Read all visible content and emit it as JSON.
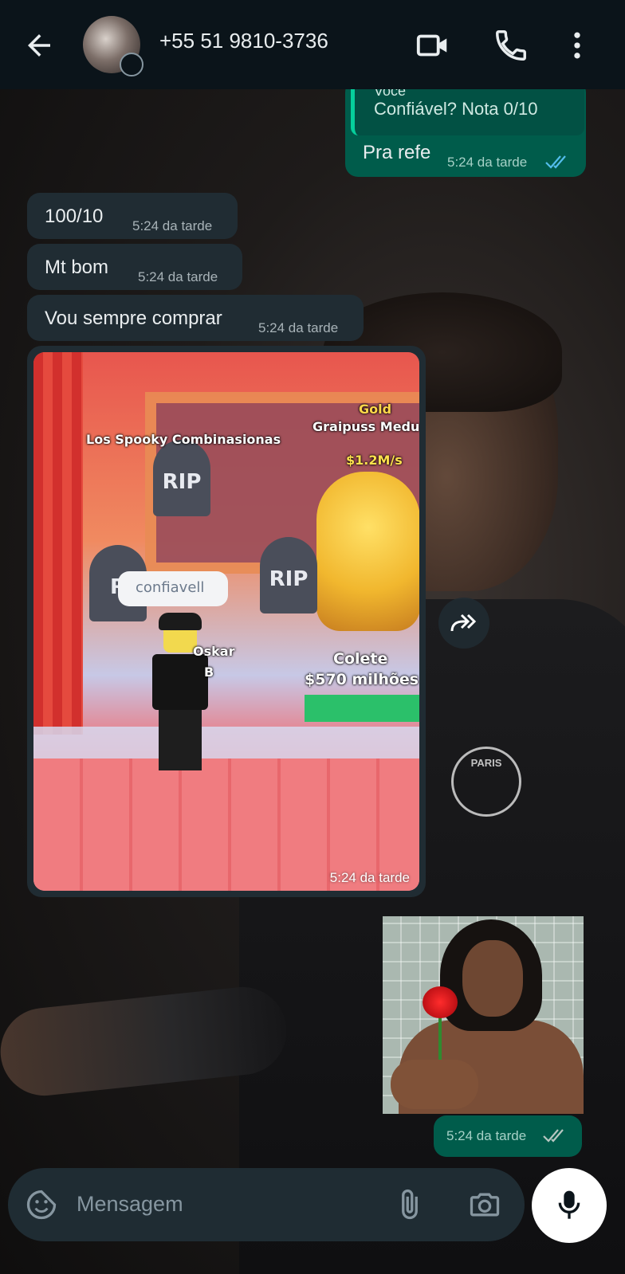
{
  "header": {
    "contact_name": "+55 51 9810-3736",
    "icons": [
      "back-arrow-icon",
      "video-call-icon",
      "phone-call-icon",
      "more-options-icon"
    ]
  },
  "messages": {
    "quoted": {
      "sender_partial": "Você",
      "text": "Confiável? Nota 0/10"
    },
    "m1": {
      "text": "Pra refe",
      "time": "5:24 da tarde",
      "status": "read"
    },
    "m2": {
      "text": "100/10",
      "time": "5:24 da tarde"
    },
    "m3": {
      "text": "Mt bom",
      "time": "5:24 da tarde"
    },
    "m4": {
      "text": "Vou sempre comprar",
      "time": "5:24 da tarde"
    },
    "media": {
      "time": "5:24 da tarde",
      "game_text": {
        "sign_title": "Los Spooky Combinasionas",
        "gold": "Gold",
        "pet_name": "Graipuss Medu",
        "rate": "$1.2M/s",
        "tomb1": "RIP",
        "tomb2": "RIP",
        "tomb3": "R",
        "chat": "confiavell",
        "name_tag_part1": "Oskar",
        "name_tag_part2": "B",
        "collect": "Colete",
        "amount": "$570 milhões"
      }
    },
    "photo_time": "5:24 da tarde"
  },
  "composer": {
    "placeholder": "Mensagem"
  },
  "wallpaper": {
    "crest": "PARIS"
  },
  "colors": {
    "header_bg": "#0b141a",
    "incoming_bubble": "#202c33",
    "outgoing_bubble": "#005c4b",
    "read_ticks": "#53bdeb"
  }
}
